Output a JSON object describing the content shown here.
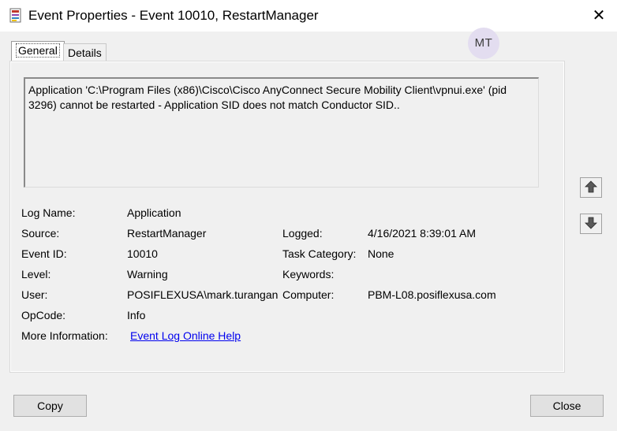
{
  "window": {
    "title": "Event Properties - Event 10010, RestartManager",
    "close_glyph": "✕",
    "avatar_initials": "MT"
  },
  "tabs": [
    {
      "label": "General",
      "selected": true
    },
    {
      "label": "Details",
      "selected": false
    }
  ],
  "message": "Application 'C:\\Program Files (x86)\\Cisco\\Cisco AnyConnect Secure Mobility Client\\vpnui.exe' (pid 3296) cannot be restarted - Application SID does not match Conductor SID..",
  "fields": {
    "log_name": {
      "label": "Log Name:",
      "value": "Application"
    },
    "source": {
      "label": "Source:",
      "value": "RestartManager"
    },
    "event_id": {
      "label": "Event ID:",
      "value": "10010"
    },
    "level": {
      "label": "Level:",
      "value": "Warning"
    },
    "user": {
      "label": "User:",
      "value": "POSIFLEXUSA\\mark.turangan"
    },
    "opcode": {
      "label": "OpCode:",
      "value": "Info"
    },
    "more_info": {
      "label": "More Information:",
      "value": "Event Log Online Help"
    },
    "logged": {
      "label": "Logged:",
      "value": "4/16/2021 8:39:01 AM"
    },
    "task_category": {
      "label": "Task Category:",
      "value": "None"
    },
    "keywords": {
      "label": "Keywords:",
      "value": ""
    },
    "computer": {
      "label": "Computer:",
      "value": "PBM-L08.posiflexusa.com"
    }
  },
  "buttons": {
    "copy": "Copy",
    "close": "Close"
  },
  "icons": {
    "app": "event-viewer-icon",
    "up": "arrow-up-icon",
    "down": "arrow-down-icon"
  }
}
